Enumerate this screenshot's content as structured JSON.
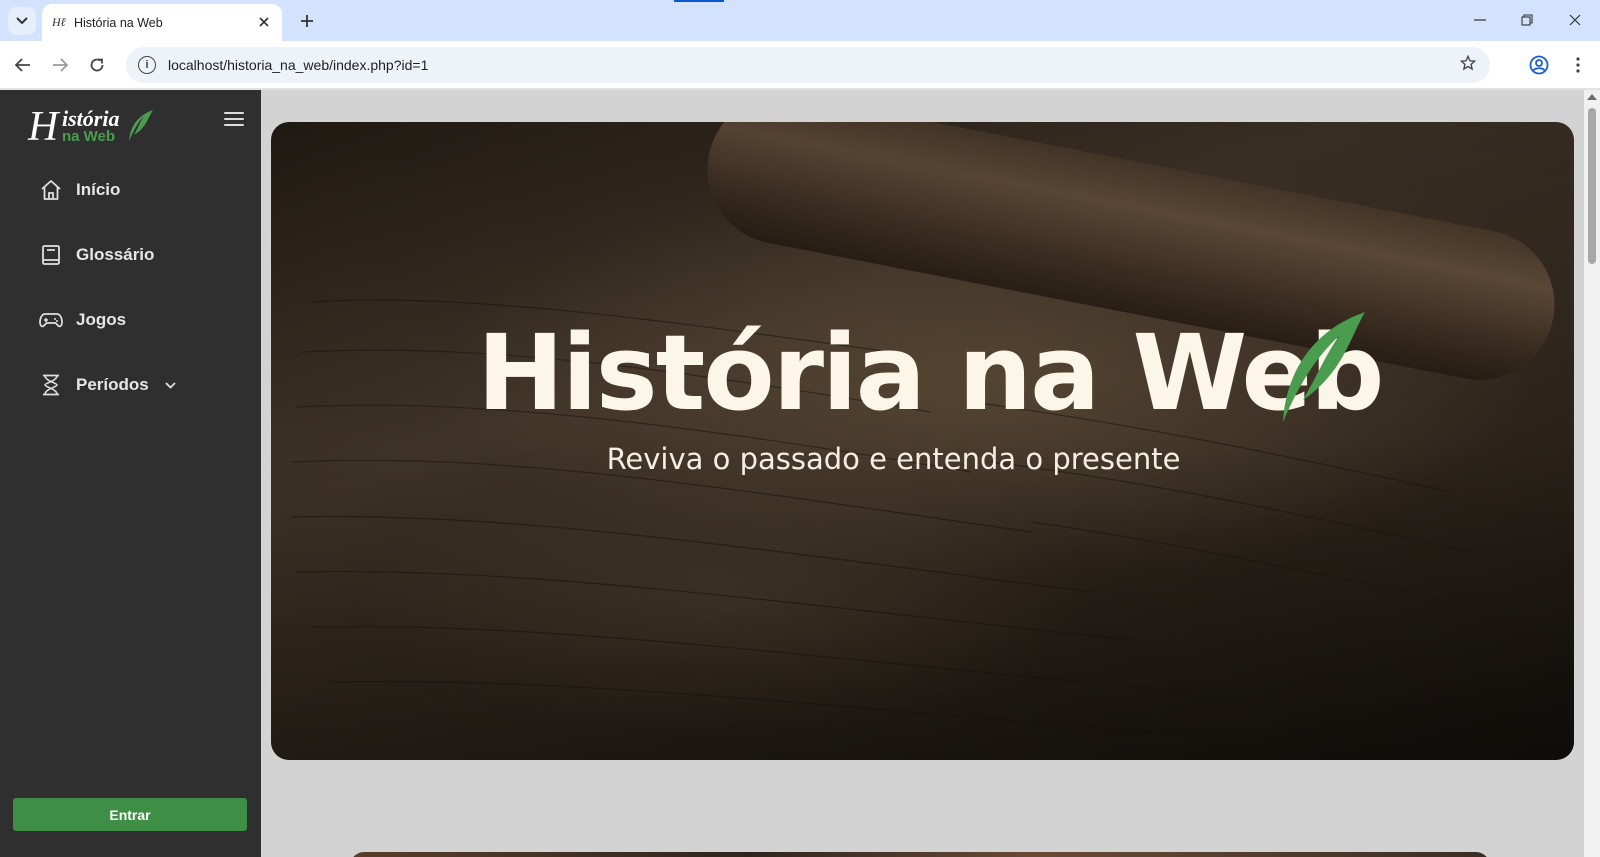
{
  "browser": {
    "tab_title": "História na Web",
    "favicon_text": "Hℓ",
    "url": "localhost/historia_na_web/index.php?id=1",
    "icons": [
      "tab-list-icon",
      "close-icon",
      "plus-icon",
      "minimize-icon",
      "restore-icon",
      "back-icon",
      "forward-icon",
      "reload-icon",
      "site-info-icon",
      "star-icon",
      "profile-icon",
      "menu-dots-icon"
    ]
  },
  "sidebar": {
    "logo": {
      "h": "H",
      "historia": "istória",
      "naweb": "na Web"
    },
    "items": [
      {
        "label": "Início",
        "icon": "home-icon"
      },
      {
        "label": "Glossário",
        "icon": "book-icon"
      },
      {
        "label": "Jogos",
        "icon": "gamepad-icon"
      },
      {
        "label": "Períodos",
        "icon": "hourglass-icon",
        "has_dropdown": true
      }
    ],
    "login_label": "Entrar"
  },
  "hero": {
    "title": "História na Web",
    "subtitle": "Reviva o passado e entenda o presente"
  },
  "colors": {
    "accent_green": "#3e8e46",
    "sidebar_bg": "#2f2f2f",
    "page_bg": "#d3d3d3"
  }
}
